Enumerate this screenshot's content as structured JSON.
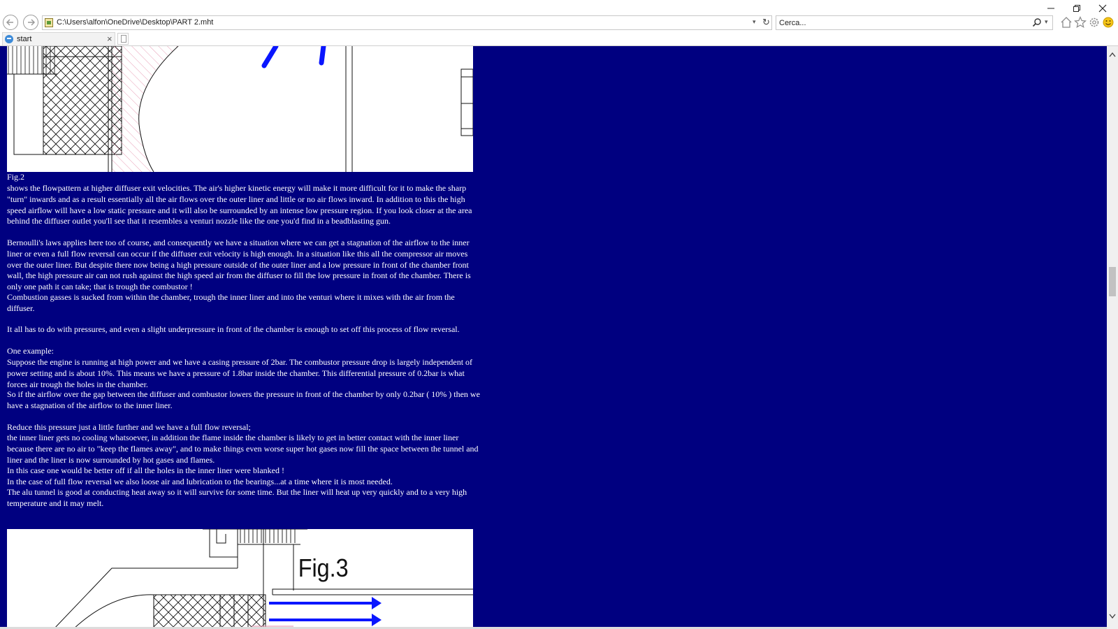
{
  "browser": {
    "address": "C:\\Users\\alfon\\OneDrive\\Desktop\\PART 2.mht",
    "search_placeholder": "Cerca...",
    "tab_label": "start"
  },
  "article": {
    "fig2_caption": "Fig.2",
    "fig2_paragraph": "shows the flowpattern at higher diffuser exit velocities. The air's higher kinetic energy will make it more difficult for it to make the sharp \"turn\" inwards and as a result essentially all the air flows over the outer liner and little or no air flows inward. In addition to this the high speed airflow will have a low static pressure and it will also be surrounded by an intense low pressure region. If you look closer at the area behind the diffuser outlet you'll see that it resembles a venturi nozzle like the one you'd find in a beadblasting gun.",
    "bernoulli_paragraph": "Bernoulli's laws applies here too of course, and consequently we have a situation where we can get a stagnation of the airflow to the inner liner or even a full flow reversal can occur if the diffuser exit velocity is high enough. In a situation like this all the compressor air moves over the outer liner. But despite there now being a high pressure outside of the outer liner and a low pressure in front of the chamber front wall, the high pressure air can not rush against the high speed air from the diffuser to fill the low pressure in front of the chamber. There is only one path it can take; that is trough the combustor !",
    "combustion_paragraph": "Combustion gasses is sucked from within the chamber, trough the inner liner and into the venturi where it mixes with the air from the diffuser.",
    "pressures_paragraph": "It all has to do with pressures, and even a slight underpressure in front of the chamber is enough to set off this process of flow reversal.",
    "example_heading": "One example:",
    "example_paragraph_1": "Suppose the engine is running at high power and we have a casing pressure of 2bar. The combustor pressure drop is largely independent of power setting and is about 10%. This means we have a pressure of 1.8bar inside the chamber. This differential pressure of 0.2bar is what forces air trough the holes in the chamber.",
    "example_paragraph_2": "So if the airflow over the gap between the diffuser and combustor lowers the pressure in front of the chamber by only 0.2bar ( 10% ) then we have a stagnation of the airflow to the inner liner.",
    "reduce_paragraph": "Reduce this pressure just a little further and we have a full flow reversal;",
    "inner_liner_paragraph": "the inner liner gets no cooling whatsoever, in addition the flame inside the chamber is likely to get in better contact with the inner liner because there are no air to \"keep the flames away\", and to make things even worse super hot gases now fill the space between the tunnel and liner and the liner is now surrounded by hot gases and flames.",
    "blanked_line": "In this case one would be better off if all the holes in the inner liner were blanked !",
    "bearings_line": "In the case of full flow reversal we also loose air and lubrication to the bearings...at a time where it is most needed.",
    "alu_paragraph": "The alu tunnel is good at conducting heat away so it will survive for some time. But the liner will heat up very quickly and to a very high temperature and it may melt.",
    "fig3_label": "Fig.3"
  },
  "colors": {
    "page_background": "#000080",
    "text": "#ffffff",
    "flow_arrow": "#0a16ff",
    "hatch_pink": "#e8a0b8"
  }
}
